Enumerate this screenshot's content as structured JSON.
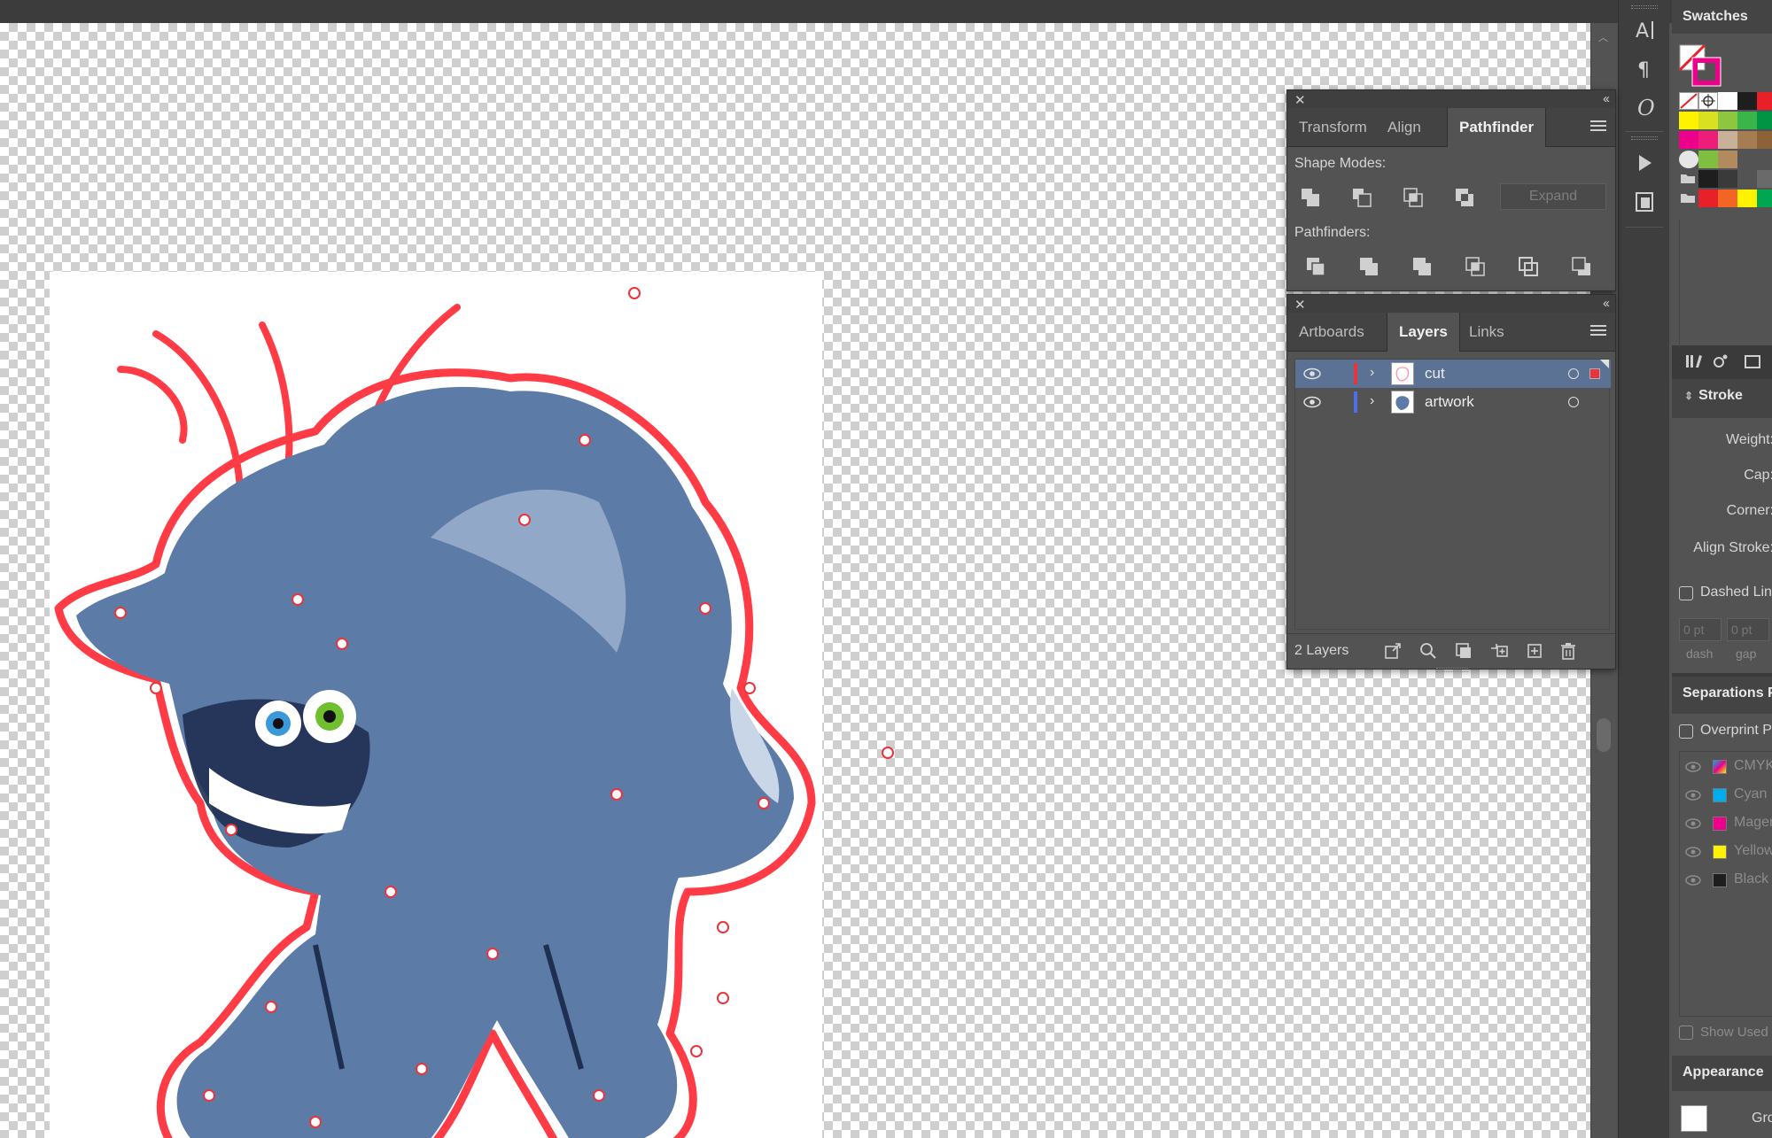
{
  "swatches_panel": {
    "title": "Swatches",
    "swatch_rows": [
      [
        "#ffffff",
        "#ffffff",
        "#ffffff",
        "#1e1e1e",
        "#e8202a"
      ],
      [
        "#fff200",
        "#d8e021",
        "#8dc63f",
        "#39b54a",
        "#009444"
      ],
      [
        "#ec008c",
        "#ed1e79",
        "#c7b299",
        "#a67c52",
        "#8c6239"
      ],
      [
        "#e6e6e6",
        "#7fbf3f",
        "#b38a5e",
        "#535353",
        "#535353"
      ],
      [
        "#535353",
        "#1e1e1e",
        "#3a3a3a",
        "#535353",
        "#6a6a6a"
      ],
      [
        "#535353",
        "#e8202a",
        "#f26522",
        "#fff200",
        "#00a651"
      ]
    ]
  },
  "stroke_panel": {
    "title": "Stroke",
    "labels": {
      "weight": "Weight:",
      "cap": "Cap:",
      "corner": "Corner:",
      "align": "Align Stroke:"
    },
    "dashed_line": "Dashed Line",
    "dash_placeholder": "0 pt",
    "gap_placeholder": "0 pt",
    "dash_label": "dash",
    "gap_label": "gap"
  },
  "separations_panel": {
    "title": "Separations Preview",
    "overprint": "Overprint Preview",
    "rows": [
      {
        "name": "CMYK",
        "color": "#8a8a8a"
      },
      {
        "name": "Cyan",
        "color": "#00aeef"
      },
      {
        "name": "Magenta",
        "color": "#ec008c"
      },
      {
        "name": "Yellow",
        "color": "#fff200"
      },
      {
        "name": "Black",
        "color": "#1e1e1e"
      }
    ],
    "show_used": "Show Used Spot Colors Only"
  },
  "appearance_panel": {
    "title": "Appearance",
    "group_label": "Group"
  },
  "pathfinder_panel": {
    "tabs": [
      "Transform",
      "Align",
      "Pathfinder"
    ],
    "active_tab": "Pathfinder",
    "shape_modes_label": "Shape Modes:",
    "pathfinders_label": "Pathfinders:",
    "expand_label": "Expand"
  },
  "layers_panel": {
    "tabs": [
      "Artboards",
      "Layers",
      "Links"
    ],
    "active_tab": "Layers",
    "layers": [
      {
        "name": "cut",
        "color": "#e8343c",
        "selected": true
      },
      {
        "name": "artwork",
        "color": "#4f6fe6",
        "selected": false
      }
    ],
    "count_label": "2 Layers"
  },
  "artwork": {
    "outline_color": "#ff3b45",
    "body_color": "#5c7ba6",
    "dark_color": "#1f2f52"
  }
}
